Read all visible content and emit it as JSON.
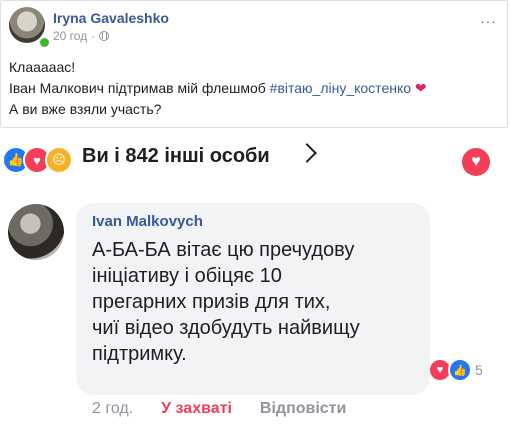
{
  "post": {
    "author": "Iryna Gavaleshko",
    "time": "20 год",
    "lines": [
      "Клааааас!",
      "Іван Малкович підтримав мій флешмоб",
      "#вітаю_ліну_костенко",
      "А ви вже взяли участь?"
    ],
    "more_label": "···"
  },
  "reactions": {
    "summary": "Ви і 842 інші особи",
    "icons": [
      "like-icon",
      "love-icon",
      "sad-icon"
    ],
    "colors": {
      "like": "#2078f4",
      "love": "#f33e58",
      "sad": "#f7b125"
    }
  },
  "comment": {
    "author": "Ivan Malkovych",
    "text": "А-БА-БА вітає цю пречудову\nініціативу і обіцяє 10\nпрегарних  призів для тих,\nчиї відео здобудуть найвищу\nпідтримку.",
    "reaction_count": "5",
    "time": "2 год.",
    "reacted_label": "У захваті",
    "reply_label": "Відповісти"
  }
}
